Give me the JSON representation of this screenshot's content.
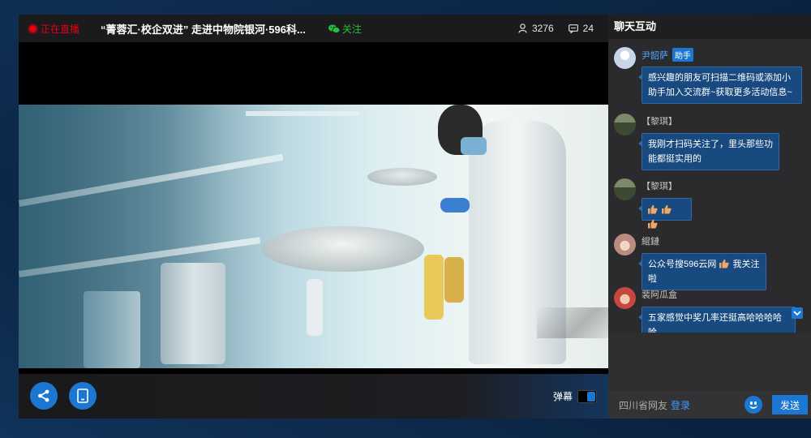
{
  "colors": {
    "accent": "#1c77d2",
    "live_red": "#e60012",
    "follow_green": "#26c13a",
    "bubble_bg": "#184a7f"
  },
  "live": {
    "status_label": "正在直播",
    "title": "“菁蓉汇·校企双进” 走进中物院银河·596科...",
    "follow_label": "关注",
    "viewers": "3276",
    "comments": "24"
  },
  "controls": {
    "share_icon": "share-icon",
    "tablet_icon": "tablet-icon",
    "danmu_label": "弹幕"
  },
  "chat": {
    "header": "聊天互动",
    "messages": [
      {
        "name": "尹韶萨",
        "badge": "助手",
        "text": "感兴趣的朋友可扫描二维码或添加小助手加入交流群~获取更多活动信息~"
      },
      {
        "name": "【黎琪】",
        "badge": "",
        "text": "我刚才扫码关注了，里头那些功能都挺实用的"
      },
      {
        "name": "【黎琪】",
        "badge": "",
        "text": ""
      },
      {
        "name": "緄鏈",
        "badge": "",
        "text_before": "公众号搜596云网",
        "text_after": "我关注啦"
      },
      {
        "name": "裴阿瓜盒",
        "badge": "",
        "text": "五家感觉中奖几率还挺高哈哈哈哈哈"
      }
    ],
    "guest_label": "四川省网友",
    "login_label": "登录",
    "send_label": "发送"
  }
}
